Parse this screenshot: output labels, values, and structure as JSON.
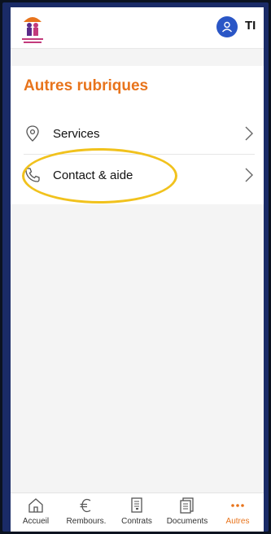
{
  "header": {
    "initials": "TI"
  },
  "section": {
    "title": "Autres rubriques",
    "items": [
      {
        "label": "Services"
      },
      {
        "label": "Contact & aide"
      }
    ]
  },
  "tabs": [
    {
      "label": "Accueil"
    },
    {
      "label": "Rembours."
    },
    {
      "label": "Contrats"
    },
    {
      "label": "Documents"
    },
    {
      "label": "Autres"
    }
  ],
  "colors": {
    "accent": "#e8741c",
    "avatar": "#2a56c6",
    "highlight": "#f1c21d"
  }
}
